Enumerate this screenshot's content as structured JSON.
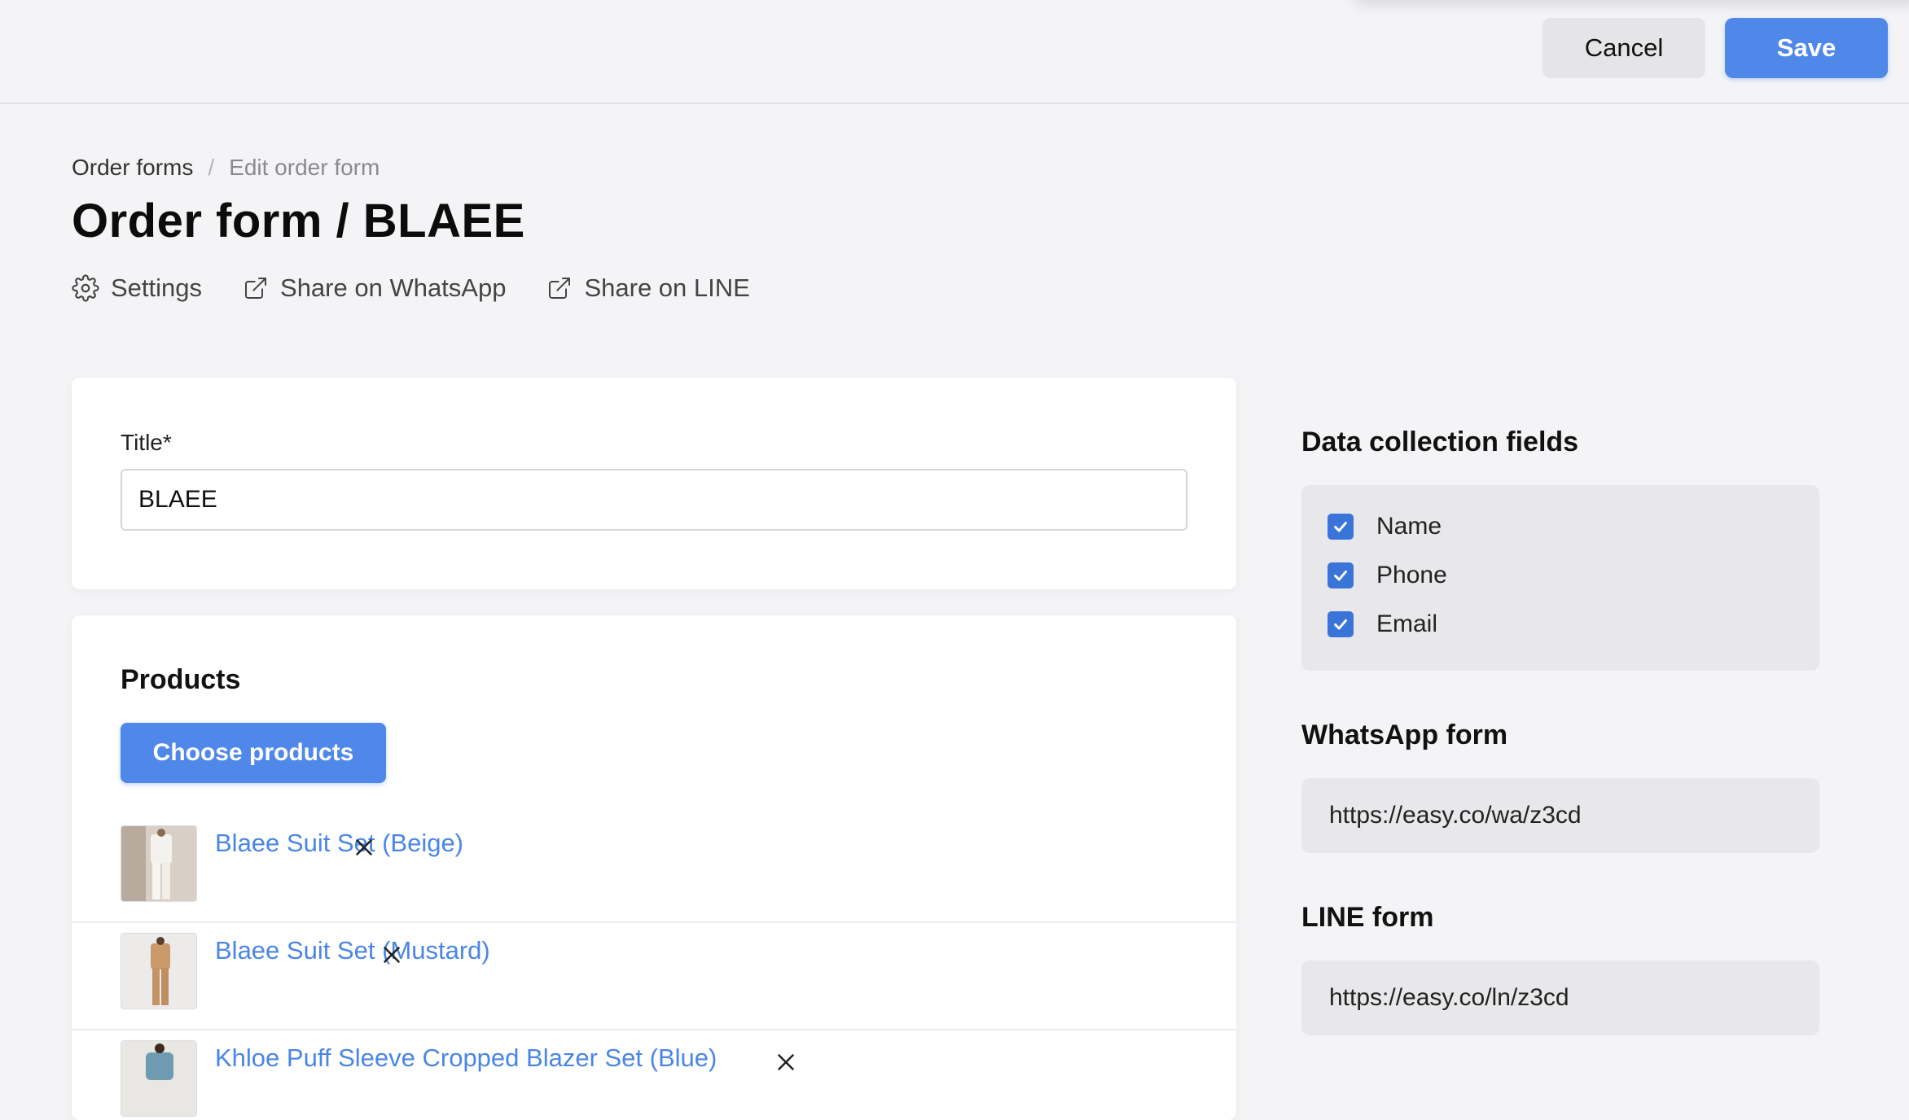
{
  "topbar": {
    "cancel_label": "Cancel",
    "save_label": "Save"
  },
  "breadcrumb": {
    "parent": "Order forms",
    "separator": "/",
    "current": "Edit order form"
  },
  "page": {
    "title": "Order form / BLAEE"
  },
  "actions": [
    {
      "label": "Settings",
      "icon": "gear-icon"
    },
    {
      "label": "Share on WhatsApp",
      "icon": "external-link-icon"
    },
    {
      "label": "Share on LINE",
      "icon": "external-link-icon"
    }
  ],
  "title_card": {
    "label": "Title*",
    "value": "BLAEE"
  },
  "products": {
    "heading": "Products",
    "choose_label": "Choose products",
    "items": [
      {
        "name": "Blaee Suit Set (Beige)",
        "color": "#efeae6"
      },
      {
        "name": "Blaee Suit Set (Mustard)",
        "color": "#c9a27a"
      },
      {
        "name": "Khloe Puff Sleeve Cropped Blazer Set (Blue)",
        "color": "#7fa6b8"
      }
    ]
  },
  "data_collection": {
    "heading": "Data collection fields",
    "fields": [
      {
        "label": "Name",
        "checked": true
      },
      {
        "label": "Phone",
        "checked": true
      },
      {
        "label": "Email",
        "checked": true
      }
    ]
  },
  "whatsapp_form": {
    "heading": "WhatsApp form",
    "url": "https://easy.co/wa/z3cd"
  },
  "line_form": {
    "heading": "LINE form",
    "url": "https://easy.co/ln/z3cd"
  },
  "colors": {
    "accent": "#5088ea",
    "link": "#4a86e6",
    "background": "#f4f4f6"
  }
}
